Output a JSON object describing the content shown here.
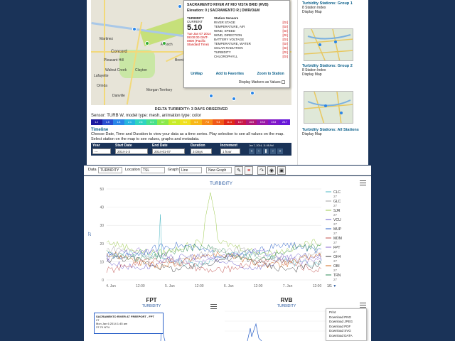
{
  "map": {
    "places": [
      "Concord",
      "Pleasant Hill",
      "Walnut Creek",
      "Lafayette",
      "Martinez",
      "Orinda",
      "Danville",
      "Clayton",
      "Antioch",
      "Morgan Territory",
      "Brentwood"
    ],
    "popup": {
      "title": "SACRAMENTO RIVER AT RIO VISTA BRID (RVB)",
      "elevation": "Elevation: 0 | SACRAMENTO R | DWR/O&M",
      "sensor_label": "TURBIDITY",
      "current_label": "CURRENT",
      "value": "5.10",
      "timestamp": "Tue Jan 07 2014 08:00:00 GMT-0800 (Pacific Standard Time)",
      "sensors_header": "Station Sensors",
      "sensors": [
        "RIVER STAGE",
        "TEMPERATURE, AIR",
        "WIND, SPEED",
        "WIND, DIRECTION",
        "BATTERY VOLTAGE",
        "TEMPERATURE, WATER",
        "SOLAR RADIATION",
        "TURBIDITY",
        "CHLOROPHYLL"
      ],
      "graph_label": "[Gr]",
      "actions": [
        "UnMap",
        "Add to Favorites",
        "Zoom to Station"
      ],
      "markers_label": "Display Markers as Values"
    }
  },
  "legend": {
    "title": "DELTA TURBIDITY: 3 DAYS OBSERVED",
    "sensor_line": "Sensor: TURB W, model type: mesh, animation type: color",
    "colors": [
      "#1a1aa0",
      "#2a4fd0",
      "#2a86e8",
      "#26b4e0",
      "#2fd4c0",
      "#48e08a",
      "#8ae84a",
      "#c8ec28",
      "#f0e020",
      "#f8b818",
      "#f88a18",
      "#f05818",
      "#e02818",
      "#c81848",
      "#b01878",
      "#9818a8",
      "#8018c8",
      "#6818d8"
    ],
    "values": [
      "1.2",
      "1.5",
      "1.8",
      "2.1",
      "2.6",
      "3.1",
      "3.7",
      "4.5",
      "5.4",
      "6.4",
      "7.8",
      "9.4",
      "11.4",
      "13.7",
      "16.5",
      "19.8",
      "23.8",
      "28.7"
    ]
  },
  "timeline": {
    "title": "Timeline",
    "desc": "Choose Date, Time and Duration to view your data as a time series. Play selection to see all values on the map. Select station on the map to see values, graphs and metadata.",
    "year_label": "Year",
    "year_value": "---",
    "start_label": "Start Date",
    "start_value": "2014-1-3",
    "end_label": "End Date",
    "end_value": "2014-01-07",
    "duration_label": "Duration",
    "duration_value": "3 Days",
    "increment_label": "Increment",
    "increment_value": "1 hour",
    "current_time": "Jan 7, 2014, 11:08 AM"
  },
  "sidebar": {
    "groups": [
      {
        "title": "Turbidity Stations:  Group 1",
        "sub1": "8 Station Index",
        "sub2": "Display Map"
      },
      {
        "title": "Turbidity Stations:  Group 2",
        "sub1": "8 Station Index",
        "sub2": "Display Map"
      },
      {
        "title": "Turbidity Stations:  All Stations",
        "sub1": "Display Map",
        "sub2": ""
      }
    ]
  },
  "toolbar": {
    "data_label": "Data",
    "data_value": "TURBIDITY",
    "location_label": "Location",
    "location_value": "TSL",
    "graph_label": "Graph",
    "graph_value": "Line",
    "new_graph": "New Graph"
  },
  "chart_data": {
    "type": "line",
    "title": "TURBIDITY",
    "ylabel": "27",
    "ylim": [
      0,
      50
    ],
    "yticks": [
      "50",
      "40",
      "30",
      "20",
      "10",
      "0"
    ],
    "xticks": [
      "4. Jan",
      "12:00",
      "5. Jan",
      "12:00",
      "6. Jan",
      "12:00",
      "7. Jan",
      "12:00"
    ],
    "legend": [
      {
        "name": "CLC",
        "sub": "27",
        "color": "#4cb8c4"
      },
      {
        "name": "GLC",
        "sub": "27",
        "color": "#a0a0a0"
      },
      {
        "name": "SJR",
        "sub": "27",
        "color": "#9bc94a"
      },
      {
        "name": "VCU",
        "sub": "27",
        "color": "#6a5acd"
      },
      {
        "name": "MUP",
        "sub": "27",
        "color": "#2a60c8"
      },
      {
        "name": "MDM",
        "sub": "27",
        "color": "#c0504d"
      },
      {
        "name": "FPT",
        "sub": "27",
        "color": "#8a6ad0"
      },
      {
        "name": "OH4",
        "sub": "27",
        "color": "#3a3a3a"
      },
      {
        "name": "OBI",
        "sub": "27",
        "color": "#d2691e"
      },
      {
        "name": "TRN",
        "sub": "27",
        "color": "#2e8b57"
      }
    ],
    "page": "1/1"
  },
  "bottom": {
    "left_title": "FPT",
    "left_sub": "TURBIDITY",
    "tooltip_title": "SACRAMENTO RIVER AT FREEPORT - FPT",
    "tooltip_lines": [
      "27",
      "Mon Jan 6 2014 1:45 am",
      "37.70 NTU"
    ],
    "right_title": "RVB",
    "right_sub": "TURBIDITY",
    "menu_items": [
      "Print",
      "Download PNG",
      "Download JPEG",
      "Download PDF",
      "Download SVG",
      "Download DATA"
    ]
  }
}
